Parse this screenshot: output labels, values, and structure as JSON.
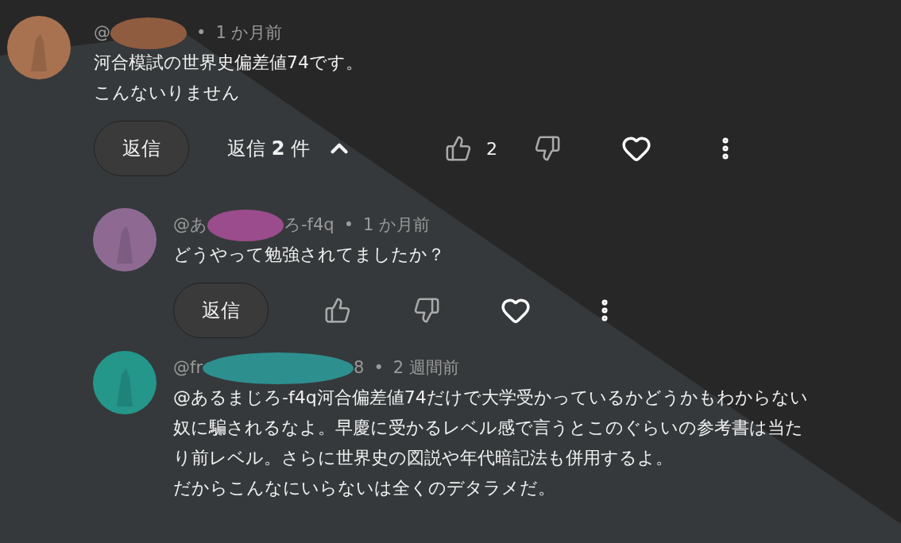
{
  "comments": [
    {
      "kind": "top",
      "name_start": "@",
      "separator": "•",
      "time": "1 か月前",
      "lines": [
        "河合模試の世界史偏差値74です。",
        "こんないりません"
      ],
      "reply_button": "返信",
      "replies_toggle": {
        "label": "返信",
        "count": "2",
        "unit": "件",
        "expanded": true
      },
      "likes": "2"
    },
    {
      "kind": "reply",
      "name_start": "@あ",
      "name_end": "ろ-f4q",
      "separator": "•",
      "time": "1 か月前",
      "lines": [
        "どうやって勉強されてましたか？"
      ],
      "reply_button": "返信"
    },
    {
      "kind": "reply",
      "name_start": "@fr",
      "name_end": "8",
      "separator": "•",
      "time": "2 週間前",
      "lines": [
        "@あるまじろ-f4q河合偏差値74だけで大学受かっているかどうかもわからない",
        "奴に騙されるなよ。早慶に受かるレベル感で言うとこのぐらいの参考書は当た",
        "り前レベル。さらに世界史の図説や年代暗記法も併用するよ。",
        "だからこんなにいらないは全くのデタラメだ。"
      ]
    }
  ]
}
